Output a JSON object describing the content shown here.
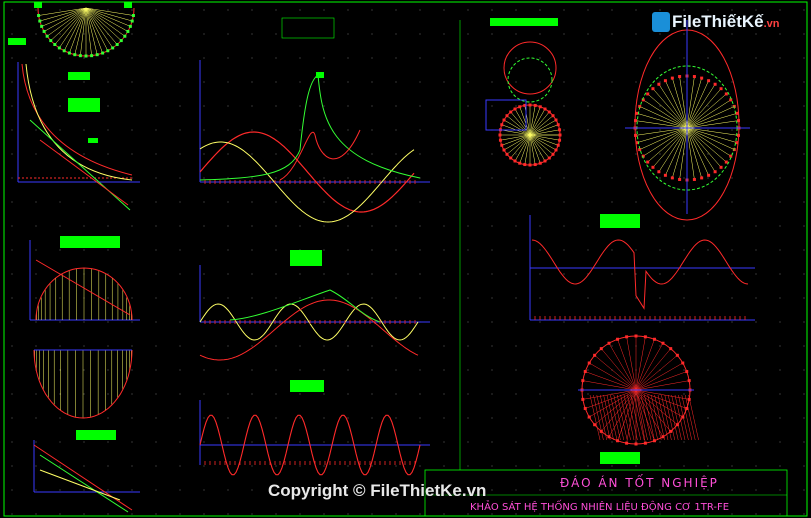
{
  "watermark": {
    "brand": "FileThiếtKế",
    "domain": ".vn",
    "copyright": "Copyright © FileThietKe.vn"
  },
  "title_block": {
    "main": "ĐÁO ÁN TỐT NGHIỆP",
    "sub": "KHẢO SÁT HỆ THỐNG NHIÊN LIỆU ĐỘNG CƠ 1TR-FE"
  },
  "colors": {
    "background": "#000000",
    "frame": "#00ff00",
    "curve_red": "#ff2a2a",
    "curve_yellow": "#ffff66",
    "curve_green": "#33ff33",
    "curve_white": "#ffffff",
    "axis_blue": "#3a3aff",
    "label_green": "#00ff00",
    "title_magenta": "#ff4fd8"
  },
  "icons": [
    "file-logo-icon"
  ]
}
